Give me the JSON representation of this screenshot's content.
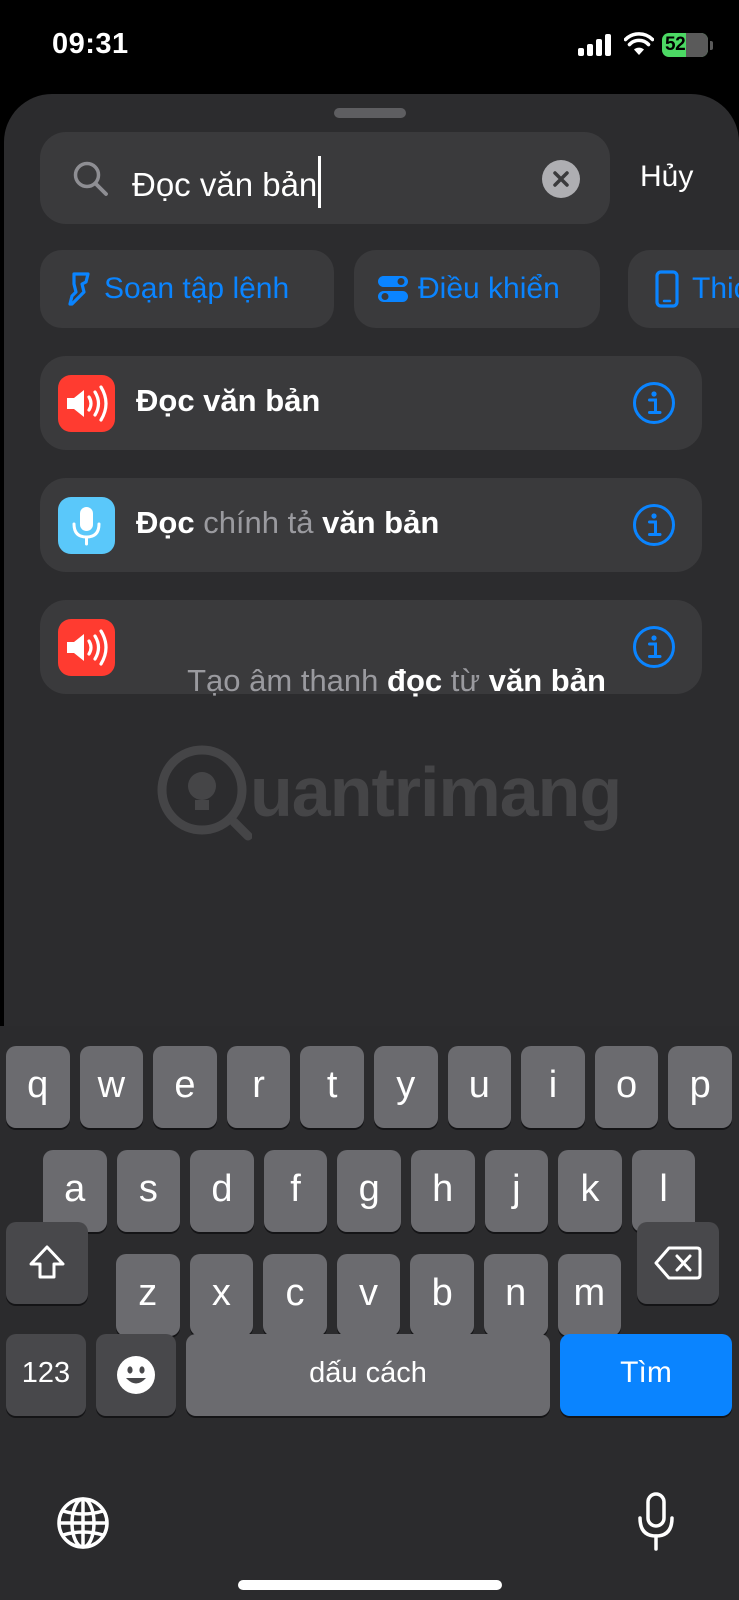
{
  "status_bar": {
    "time": "09:31",
    "battery": "52"
  },
  "search": {
    "query": "Đọc văn bản",
    "cancel_label": "Hủy"
  },
  "categories": [
    {
      "label": "Soạn tập lệnh",
      "icon": "script-icon"
    },
    {
      "label": "Điều khiển",
      "icon": "toggle-icon"
    },
    {
      "label": "Thic",
      "icon": "phone-icon"
    }
  ],
  "actions": [
    {
      "parts": [
        {
          "text": "Đọc văn bản",
          "style": "hl"
        }
      ],
      "icon": "speaker-icon",
      "color": "#ff3b30"
    },
    {
      "parts": [
        {
          "text": "Đọc",
          "style": "hl"
        },
        {
          "text": " chính tả ",
          "style": "dim"
        },
        {
          "text": "văn bản",
          "style": "hl"
        }
      ],
      "icon": "microphone-icon",
      "color": "#5ac8fa"
    },
    {
      "parts": [
        {
          "text": "Tạo âm thanh ",
          "style": "dim"
        },
        {
          "text": "đọc",
          "style": "hl"
        },
        {
          "text": " từ ",
          "style": "dim"
        },
        {
          "text": "văn bản",
          "style": "hl"
        }
      ],
      "icon": "speaker-icon",
      "color": "#ff3b30"
    }
  ],
  "watermark": {
    "text": "uantrimang"
  },
  "keyboard": {
    "row1": [
      "q",
      "w",
      "e",
      "r",
      "t",
      "y",
      "u",
      "i",
      "o",
      "p"
    ],
    "row2": [
      "a",
      "s",
      "d",
      "f",
      "g",
      "h",
      "j",
      "k",
      "l"
    ],
    "row3": [
      "z",
      "x",
      "c",
      "v",
      "b",
      "n",
      "m"
    ],
    "numbers_label": "123",
    "space_label": "dấu cách",
    "return_label": "Tìm"
  },
  "colors": {
    "accent": "#0a84ff",
    "sheet": "#2c2c2e",
    "field": "#3a3a3c"
  }
}
